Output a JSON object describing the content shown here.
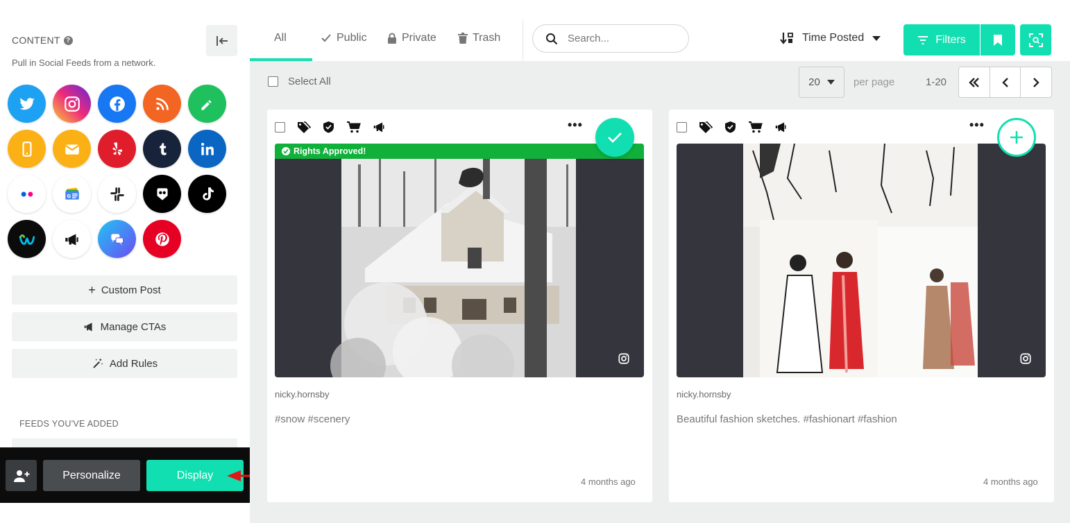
{
  "sidebar": {
    "title": "CONTENT",
    "subtitle": "Pull in Social Feeds from a network.",
    "networks": [
      {
        "name": "twitter",
        "color": "#1da1f2"
      },
      {
        "name": "instagram",
        "color": "#dd2a7b"
      },
      {
        "name": "facebook",
        "color": "#1877f2"
      },
      {
        "name": "rss",
        "color": "#f26522"
      },
      {
        "name": "custom-pencil",
        "color": "#1fc05e"
      },
      {
        "name": "mobile",
        "color": "#fbb116"
      },
      {
        "name": "email",
        "color": "#fbb116"
      },
      {
        "name": "yelp",
        "color": "#e01e2b"
      },
      {
        "name": "tumblr",
        "color": "#16233a"
      },
      {
        "name": "linkedin",
        "color": "#0a66c2"
      },
      {
        "name": "flickr",
        "color": "#ffffff"
      },
      {
        "name": "google-news",
        "color": "#ffffff"
      },
      {
        "name": "slack",
        "color": "#ffffff"
      },
      {
        "name": "tripadvisor",
        "color": "#000000"
      },
      {
        "name": "tiktok",
        "color": "#000000"
      },
      {
        "name": "webex",
        "color": "#0b0b0b"
      },
      {
        "name": "megaphone",
        "color": "#ffffff"
      },
      {
        "name": "chat",
        "color": "#5b5ef5"
      },
      {
        "name": "pinterest",
        "color": "#e60023"
      }
    ],
    "actions": [
      {
        "label": "Custom Post",
        "icon": "plus-icon"
      },
      {
        "label": "Manage CTAs",
        "icon": "megaphone-icon"
      },
      {
        "label": "Add Rules",
        "icon": "magic-wand-icon"
      }
    ],
    "feeds_label": "FEEDS YOU'VE ADDED",
    "personalize_label": "Personalize",
    "display_label": "Display"
  },
  "topbar": {
    "tabs": [
      {
        "label": "All",
        "icon": ""
      },
      {
        "label": "Public",
        "icon": "check-icon"
      },
      {
        "label": "Private",
        "icon": "lock-icon"
      },
      {
        "label": "Trash",
        "icon": "trash-icon"
      }
    ],
    "search_placeholder": "Search...",
    "sort_label": "Time Posted",
    "filters_label": "Filters"
  },
  "toolbar": {
    "select_all_label": "Select All",
    "per_page_value": "20",
    "per_page_label": "per page",
    "range": "1-20"
  },
  "posts": [
    {
      "author": "nicky.hornsby",
      "caption": "#snow #scenery",
      "time": "4 months ago",
      "badge": "Rights Approved!",
      "network": "instagram",
      "selected": true
    },
    {
      "author": "nicky.hornsby",
      "caption": "Beautiful fashion sketches. #fashionart #fashion",
      "time": "4 months ago",
      "badge": "",
      "network": "instagram",
      "selected": false
    }
  ],
  "accent_color": "#12dfb1"
}
